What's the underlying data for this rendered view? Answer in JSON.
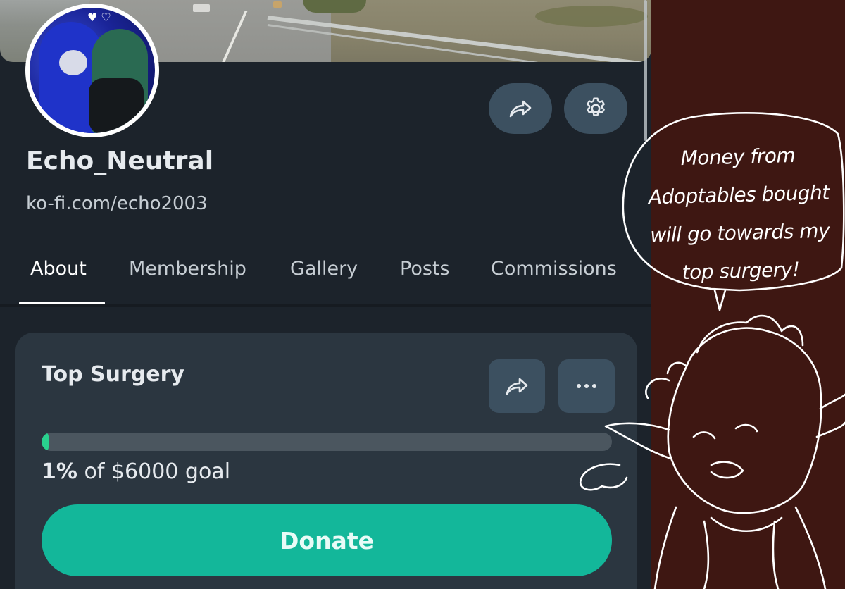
{
  "profile": {
    "username": "Echo_Neutral",
    "url": "ko-fi.com/echo2003",
    "banner_icon": "highway-photo",
    "avatar_icon": "character-art-avatar"
  },
  "actions": {
    "share_icon": "share-arrow-icon",
    "settings_icon": "gear-icon"
  },
  "tabs": [
    {
      "label": "About",
      "active": true
    },
    {
      "label": "Membership",
      "active": false
    },
    {
      "label": "Gallery",
      "active": false
    },
    {
      "label": "Posts",
      "active": false
    },
    {
      "label": "Commissions",
      "active": false
    }
  ],
  "goal": {
    "title": "Top Surgery",
    "percent_label": "1%",
    "goal_suffix": "of $6000 goal",
    "progress_fraction": 0.01,
    "donate_label": "Donate",
    "more_icon": "more-dots-icon"
  },
  "overlay": {
    "speech_text": "Money from Adoptables bought will go towards my top surgery!",
    "drawing_icon": "hand-drawn-character"
  },
  "colors": {
    "page_bg": "#1c232b",
    "card_bg": "#2b3640",
    "button_bg": "#3c5060",
    "accent": "#13b79a",
    "progress": "#29d18e",
    "panel_bg": "#3e1712"
  }
}
